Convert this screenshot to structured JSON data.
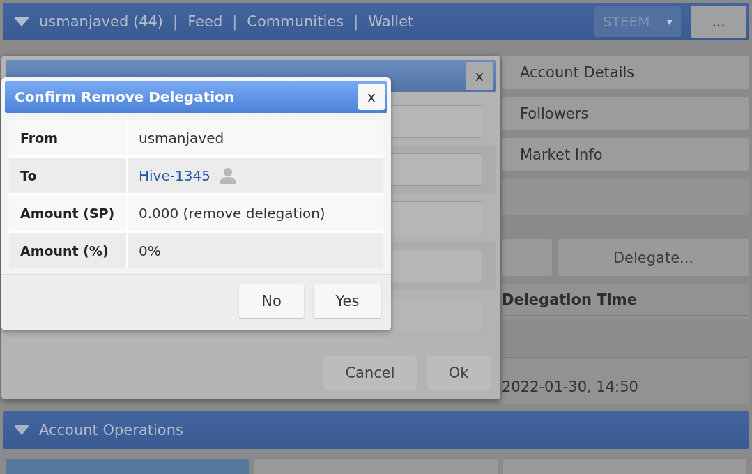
{
  "top_bar": {
    "user": "usmanjaved (44)",
    "links": [
      {
        "separator": "|",
        "label": "Feed"
      },
      {
        "separator": "|",
        "label": "Communities"
      },
      {
        "separator": "|",
        "label": "Wallet"
      }
    ],
    "currency": "STEEM",
    "currency_caret": "▼",
    "more": "..."
  },
  "side_menu": [
    "Account Details",
    "Followers",
    "Market Info"
  ],
  "delegations": {
    "delegate_button": "Delegate...",
    "column": "Delegation Time",
    "rows": [
      "2022-01-30, 14:50"
    ]
  },
  "section": {
    "title": "Account Operations"
  },
  "tabs": [
    {
      "selected": true
    },
    {
      "selected": false
    },
    {
      "selected": false
    }
  ],
  "delegate_dialog": {
    "close": "x",
    "buttons": [
      "Cancel",
      "Ok"
    ]
  },
  "confirm_dialog": {
    "title": "Confirm Remove Delegation",
    "close": "x",
    "rows": [
      {
        "label": "From",
        "value": "usmanjaved",
        "kind": "text"
      },
      {
        "label": "To",
        "value": "Hive-1345",
        "kind": "account"
      },
      {
        "label": "Amount (SP)",
        "value": "0.000 (remove delegation)",
        "kind": "text"
      },
      {
        "label": "Amount (%)",
        "value": "0%",
        "kind": "text"
      }
    ],
    "buttons": [
      "No",
      "Yes"
    ]
  }
}
